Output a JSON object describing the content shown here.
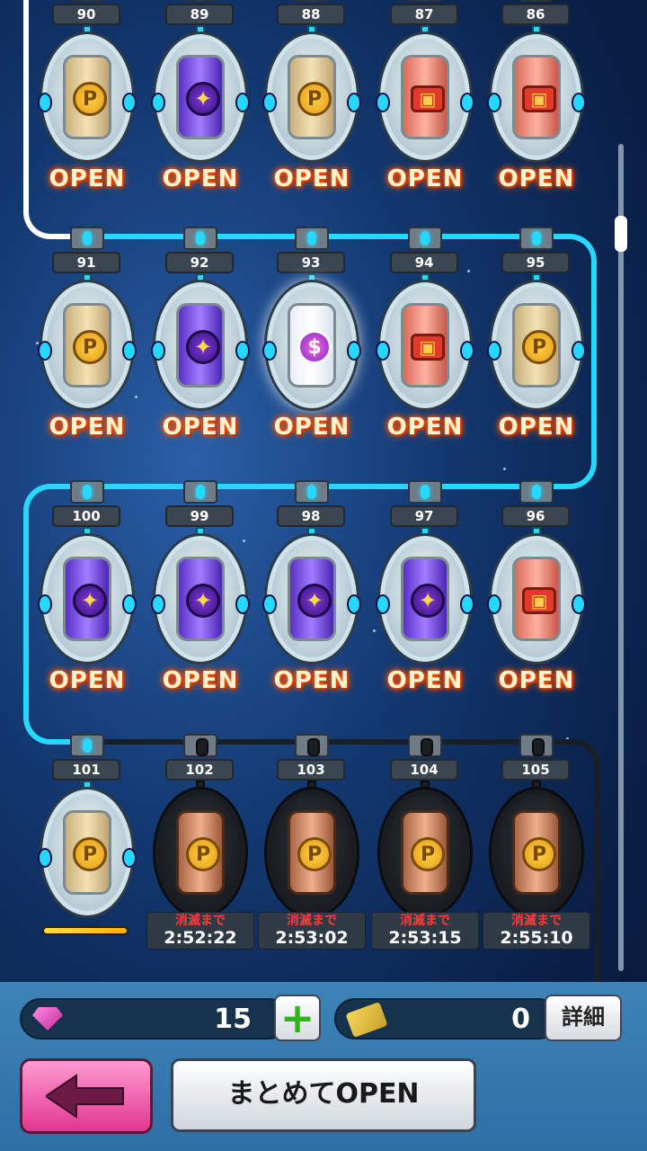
{
  "rows": [
    {
      "capsules": [
        {
          "num": "90",
          "icon": "gold-p-icon",
          "status": "OPEN"
        },
        {
          "num": "89",
          "icon": "shuriken-icon",
          "status": "OPEN"
        },
        {
          "num": "88",
          "icon": "gold-p-icon",
          "status": "OPEN"
        },
        {
          "num": "87",
          "icon": "briefcase-icon",
          "status": "OPEN"
        },
        {
          "num": "86",
          "icon": "briefcase-icon",
          "status": "OPEN"
        }
      ]
    },
    {
      "capsules": [
        {
          "num": "91",
          "icon": "gold-p-icon",
          "status": "OPEN"
        },
        {
          "num": "92",
          "icon": "shuriken-icon",
          "status": "OPEN"
        },
        {
          "num": "93",
          "icon": "rainbow-s-icon",
          "status": "OPEN"
        },
        {
          "num": "94",
          "icon": "briefcase-icon",
          "status": "OPEN"
        },
        {
          "num": "95",
          "icon": "gold-p-icon",
          "status": "OPEN"
        }
      ]
    },
    {
      "capsules": [
        {
          "num": "100",
          "icon": "shuriken-icon",
          "status": "OPEN"
        },
        {
          "num": "99",
          "icon": "shuriken-icon",
          "status": "OPEN"
        },
        {
          "num": "98",
          "icon": "shuriken-icon",
          "status": "OPEN"
        },
        {
          "num": "97",
          "icon": "shuriken-icon",
          "status": "OPEN"
        },
        {
          "num": "96",
          "icon": "briefcase-icon",
          "status": "OPEN"
        }
      ]
    },
    {
      "capsules": [
        {
          "num": "101",
          "icon": "gold-p-icon",
          "status": "progress",
          "progress": 1.0
        },
        {
          "num": "102",
          "icon": "gold-p-icon",
          "status": "locked",
          "timer_label": "消滅まで",
          "timer": "2:52:22"
        },
        {
          "num": "103",
          "icon": "gold-p-icon",
          "status": "locked",
          "timer_label": "消滅まで",
          "timer": "2:53:02"
        },
        {
          "num": "104",
          "icon": "gold-p-icon",
          "status": "locked",
          "timer_label": "消滅まで",
          "timer": "2:53:15"
        },
        {
          "num": "105",
          "icon": "gold-p-icon",
          "status": "locked",
          "timer_label": "消滅まで",
          "timer": "2:55:10"
        }
      ]
    }
  ],
  "footer": {
    "gems": "15",
    "tickets": "0",
    "detail_label": "詳細",
    "plus_label": "+",
    "open_all_label": "まとめてOPEN"
  },
  "colors": {
    "path_lit": "#24d8ff",
    "path_white": "#ffffff",
    "path_dark": "#1b1f24",
    "open_glow": "#ff5a00",
    "timer_red": "#ff3a3a"
  }
}
